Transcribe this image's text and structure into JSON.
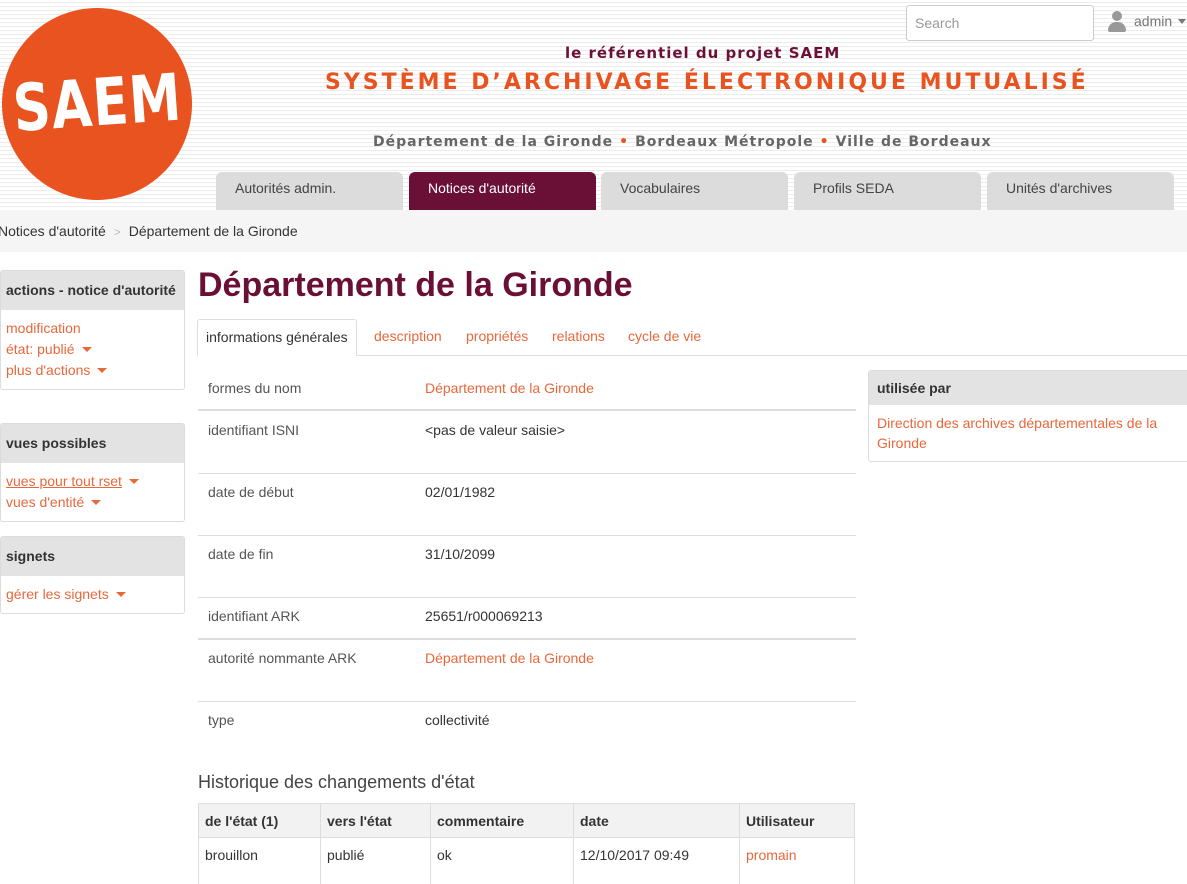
{
  "header": {
    "logo_text": "SAEM",
    "tagline": "le référentiel du projet SAEM",
    "system_title": "SYSTÈME D’ARCHIVAGE ÉLECTRONIQUE MUTUALISÉ",
    "partners": [
      "Département de la Gironde",
      "Bordeaux Métropole",
      "Ville de Bordeaux"
    ],
    "partner_separator": "•",
    "search_placeholder": "Search",
    "user_name": "admin"
  },
  "nav": {
    "tabs": [
      {
        "label": "Autorités admin.",
        "active": false
      },
      {
        "label": "Notices d'autorité",
        "active": true
      },
      {
        "label": "Vocabulaires",
        "active": false
      },
      {
        "label": "Profils SEDA",
        "active": false
      },
      {
        "label": "Unités d'archives",
        "active": false
      }
    ]
  },
  "breadcrumb": {
    "items": [
      "Notices d'autorité",
      "Département de la Gironde"
    ],
    "separator": ">"
  },
  "sidebar": {
    "actions": {
      "title": "actions - notice d'autorité",
      "items": [
        {
          "label": "modification",
          "dropdown": false
        },
        {
          "label": "état: publié",
          "dropdown": true
        },
        {
          "label": "plus d'actions",
          "dropdown": true
        }
      ]
    },
    "views": {
      "title": "vues possibles",
      "items": [
        {
          "label": "vues pour tout rset",
          "dropdown": true
        },
        {
          "label": "vues d'entité",
          "dropdown": true
        }
      ]
    },
    "bookmarks": {
      "title": "signets",
      "items": [
        {
          "label": "gérer les signets",
          "dropdown": true
        }
      ]
    }
  },
  "main": {
    "title": "Département de la Gironde",
    "tabs": [
      {
        "label": "informations générales",
        "active": true
      },
      {
        "label": "description",
        "active": false
      },
      {
        "label": "propriétés",
        "active": false
      },
      {
        "label": "relations",
        "active": false
      },
      {
        "label": "cycle de vie",
        "active": false
      }
    ],
    "attributes": [
      {
        "label": "formes du nom",
        "value": "Département de la Gironde",
        "is_link": true
      },
      {
        "label": "identifiant ISNI",
        "value": "<pas de valeur saisie>",
        "is_link": false
      },
      {
        "label": "date de début",
        "value": "02/01/1982",
        "is_link": false
      },
      {
        "label": "date de fin",
        "value": "31/10/2099",
        "is_link": false
      },
      {
        "label": "identifiant ARK",
        "value": "25651/r000069213",
        "is_link": false
      },
      {
        "label": "autorité nommante ARK",
        "value": "Département de la Gironde",
        "is_link": true
      },
      {
        "label": "type",
        "value": "collectivité",
        "is_link": false
      }
    ]
  },
  "used_by": {
    "title": "utilisée par",
    "items": [
      "Direction des archives départementales de la Gironde"
    ]
  },
  "history": {
    "title": "Historique des changements d'état",
    "columns": [
      "de l'état (1)",
      "vers l'état",
      "commentaire",
      "date",
      "Utilisateur"
    ],
    "rows": [
      [
        "brouillon",
        "publié",
        "ok",
        "12/10/2017 09:49",
        "promain"
      ]
    ]
  },
  "colors": {
    "brand_orange": "#e8531f",
    "link_orange": "#e8683c",
    "brand_burgundy": "#6a0f36"
  }
}
